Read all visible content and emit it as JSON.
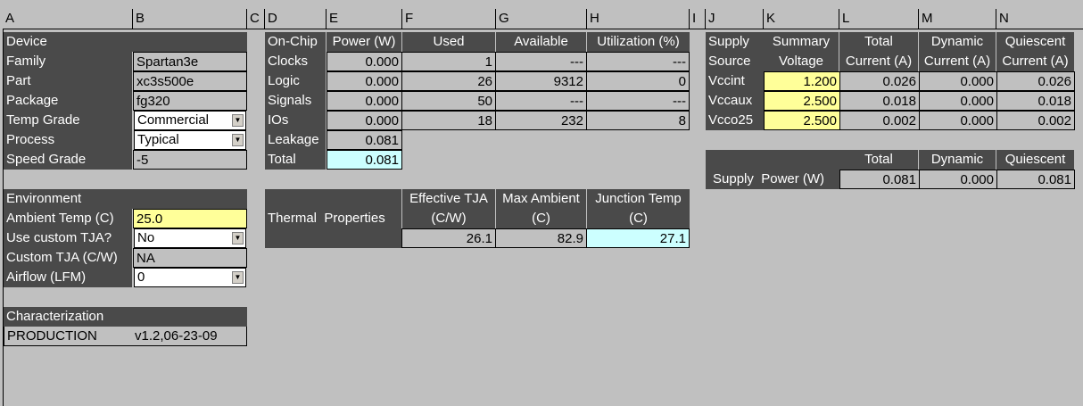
{
  "columns": [
    "A",
    "B",
    "C",
    "D",
    "E",
    "F",
    "G",
    "H",
    "I",
    "J",
    "K",
    "L",
    "M",
    "N"
  ],
  "device": {
    "header": "Device",
    "rows": [
      {
        "label": "Family",
        "value": "Spartan3e"
      },
      {
        "label": "Part",
        "value": "xc3s500e"
      },
      {
        "label": "Package",
        "value": "fg320"
      },
      {
        "label": "Temp Grade",
        "value": "Commercial"
      },
      {
        "label": "Process",
        "value": "Typical"
      },
      {
        "label": "Speed Grade",
        "value": "-5"
      }
    ]
  },
  "environment": {
    "header": "Environment",
    "rows": [
      {
        "label": "Ambient Temp (C)",
        "value": "25.0"
      },
      {
        "label": "Use custom TJA?",
        "value": "No"
      },
      {
        "label": "Custom TJA (C/W)",
        "value": "NA"
      },
      {
        "label": "Airflow (LFM)",
        "value": "0"
      }
    ]
  },
  "characterization": {
    "header": "Characterization",
    "status": "PRODUCTION",
    "version": "v1.2,06-23-09"
  },
  "onchip": {
    "headers": [
      "On-Chip",
      "Power (W)",
      "Used",
      "Available",
      "Utilization (%)"
    ],
    "rows": [
      [
        "Clocks",
        "0.000",
        "1",
        "---",
        "---"
      ],
      [
        "Logic",
        "0.000",
        "26",
        "9312",
        "0"
      ],
      [
        "Signals",
        "0.000",
        "50",
        "---",
        "---"
      ],
      [
        "IOs",
        "0.000",
        "18",
        "232",
        "8"
      ]
    ],
    "leakage_label": "Leakage",
    "leakage": "0.081",
    "total_label": "Total",
    "total": "0.081"
  },
  "thermal": {
    "label1": "Thermal",
    "label2": "Properties",
    "headers": [
      [
        "Effective TJA",
        "(C/W)"
      ],
      [
        "Max Ambient",
        "(C)"
      ],
      [
        "Junction Temp",
        "(C)"
      ]
    ],
    "values": [
      "26.1",
      "82.9",
      "27.1"
    ]
  },
  "supply": {
    "hdr_top": [
      "Supply",
      "Summary",
      "Total",
      "Dynamic",
      "Quiescent"
    ],
    "hdr_bot": [
      "Source",
      "Voltage",
      "Current (A)",
      "Current (A)",
      "Current (A)"
    ],
    "rows": [
      [
        "Vccint",
        "1.200",
        "0.026",
        "0.000",
        "0.026"
      ],
      [
        "Vccaux",
        "2.500",
        "0.018",
        "0.000",
        "0.018"
      ],
      [
        "Vcco25",
        "2.500",
        "0.002",
        "0.000",
        "0.002"
      ]
    ]
  },
  "supply_power": {
    "headers": [
      "Total",
      "Dynamic",
      "Quiescent"
    ],
    "label1": "Supply",
    "label2": "Power (W)",
    "values": [
      "0.081",
      "0.000",
      "0.081"
    ]
  }
}
